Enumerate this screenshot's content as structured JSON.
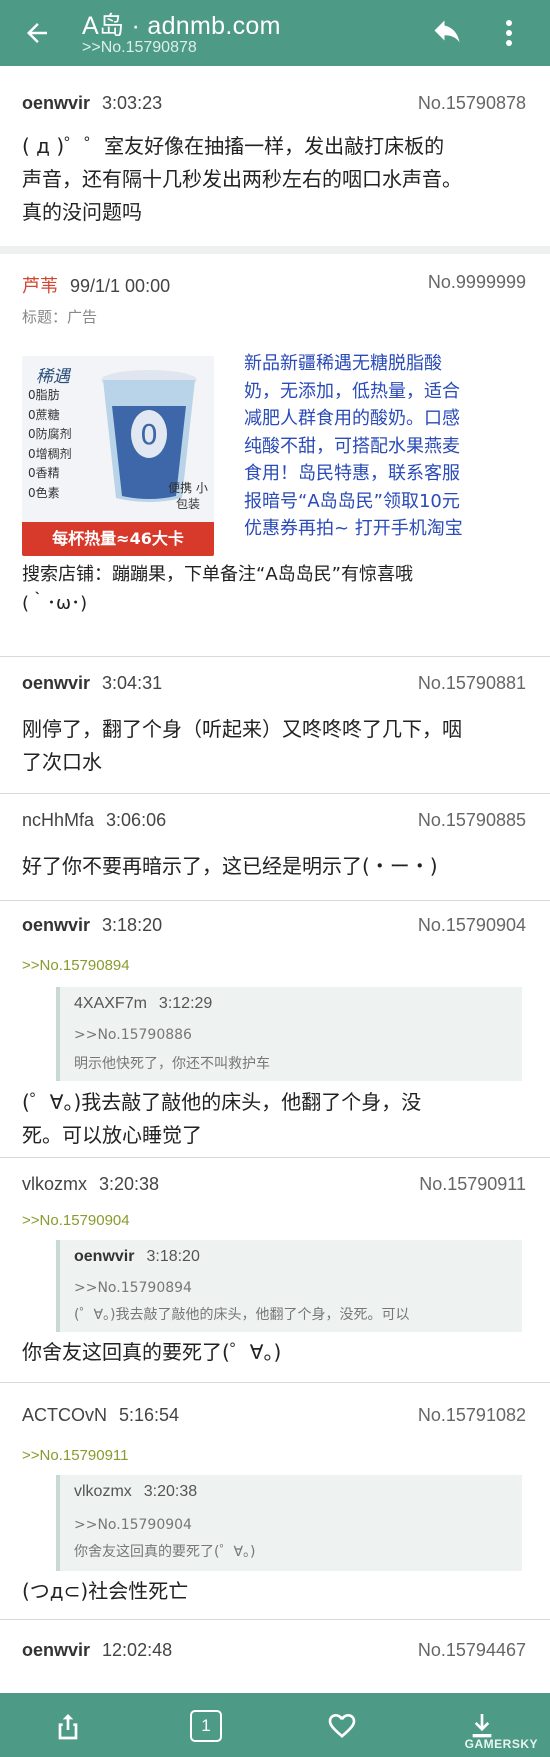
{
  "appbar": {
    "title": "A岛 · adnmb.com",
    "subtitle": ">>No.15790878"
  },
  "posts": [
    {
      "user": "oenwvir",
      "time": "3:03:23",
      "no": "No.15790878",
      "lines": [
        "( д )゜゜室友好像在抽搐一样，发出敲打床板的",
        "声音，还有隔十几秒发出两秒左右的咽口水声音。",
        "真的没问题吗"
      ]
    },
    {
      "user": "芦苇",
      "time": "99/1/1 00:00",
      "no": "No.9999999",
      "label": "标题：广告",
      "ad_product": {
        "brand": "稀遇",
        "features": [
          "0脂肪",
          "0蔗糖",
          "0防腐剂",
          "0增稠剂",
          "0香精",
          "0色素"
        ],
        "tag": "便携 小包装",
        "banner": "每杯热量≈46大卡"
      },
      "ad_lines": [
        "新品新疆稀遇无糖脱脂酸",
        "奶，无添加，低热量，适合",
        "减肥人群食用的酸奶。口感",
        "纯酸不甜，可搭配水果燕麦",
        "食用！岛民特惠，联系客服",
        "报暗号“A岛岛民”领取10元",
        "优惠券再拍~ 打开手机淘宝"
      ],
      "lines": [
        "搜索店铺：蹦蹦果，下单备注“A岛岛民”有惊喜哦",
        "(｀･ω･)"
      ]
    },
    {
      "user": "oenwvir",
      "time": "3:04:31",
      "no": "No.15790881",
      "lines": [
        "刚停了，翻了个身（听起来）又咚咚咚了几下，咽",
        "了次口水"
      ]
    },
    {
      "user": "ncHhMfa",
      "time": "3:06:06",
      "no": "No.15790885",
      "lines": [
        "好了你不要再暗示了，这已经是明示了(・ー・)"
      ]
    },
    {
      "user": "oenwvir",
      "time": "3:18:20",
      "no": "No.15790904",
      "ref": ">>No.15790894",
      "quote": {
        "user": "4XAXF7m",
        "time": "3:12:29",
        "lines": [
          ">>No.15790886",
          "明示他快死了，你还不叫救护车"
        ]
      },
      "lines": [
        "(゜∀。)我去敲了敲他的床头，他翻了个身，没",
        "死。可以放心睡觉了"
      ]
    },
    {
      "user": "vlkozmx",
      "time": "3:20:38",
      "no": "No.15790911",
      "ref": ">>No.15790904",
      "quote": {
        "user": "oenwvir",
        "time": "3:18:20",
        "lines": [
          ">>No.15790894",
          "(゜∀。)我去敲了敲他的床头，他翻了个身，没死。可以"
        ]
      },
      "lines": [
        "你舍友这回真的要死了(゜∀。)"
      ]
    },
    {
      "user": "ACTCOvN",
      "time": "5:16:54",
      "no": "No.15791082",
      "ref": ">>No.15790911",
      "quote": {
        "user": "vlkozmx",
        "time": "3:20:38",
        "lines": [
          ">>No.15790904",
          "你舍友这回真的要死了(゜∀。)"
        ]
      },
      "lines": [
        "(つд⊂)社会性死亡"
      ]
    },
    {
      "user": "oenwvir",
      "time": "12:02:48",
      "no": "No.15794467",
      "lines": []
    }
  ],
  "bottombar": {
    "page_number": "1",
    "watermark": "GAMERSKY",
    "icons": [
      "share-icon",
      "page-icon",
      "heart-icon",
      "download-icon"
    ]
  }
}
